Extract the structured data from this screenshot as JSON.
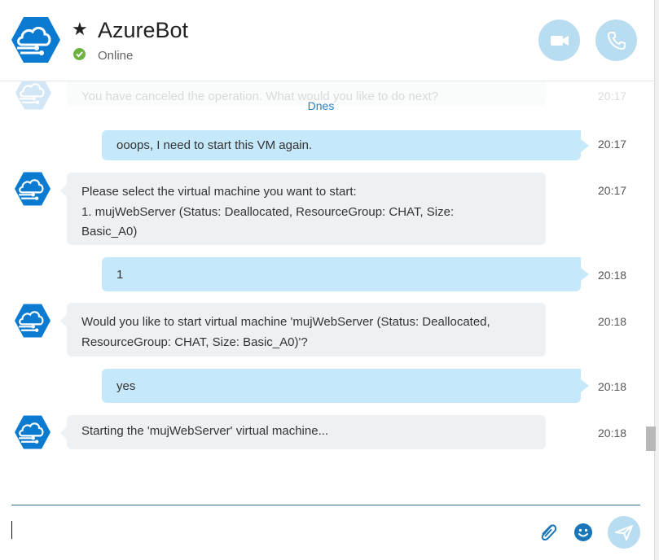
{
  "header": {
    "title": "AzureBot",
    "status": "Online",
    "favorite_icon": "star-icon",
    "video_icon": "video-camera-icon",
    "call_icon": "phone-icon"
  },
  "date_separator": "Dnes",
  "ghost_message": {
    "text": "You have canceled the operation. What would you like to do next?",
    "time": "20:17"
  },
  "messages": [
    {
      "from": "me",
      "lines": [
        "ooops, I need to start this VM again."
      ],
      "time": "20:17"
    },
    {
      "from": "bot",
      "lines": [
        "Please select the virtual machine you want to start:",
        "1. mujWebServer (Status: Deallocated, ResourceGroup: CHAT, Size:",
        "Basic_A0)"
      ],
      "time": "20:17"
    },
    {
      "from": "me",
      "lines": [
        "1"
      ],
      "time": "20:18"
    },
    {
      "from": "bot",
      "lines": [
        "Would you like to start virtual machine 'mujWebServer (Status: Deallocated,",
        "ResourceGroup: CHAT, Size: Basic_A0)'?"
      ],
      "time": "20:18"
    },
    {
      "from": "me",
      "lines": [
        "yes"
      ],
      "time": "20:18"
    },
    {
      "from": "bot",
      "lines": [
        "Starting the 'mujWebServer' virtual machine..."
      ],
      "time": "20:18"
    }
  ],
  "compose": {
    "placeholder": "",
    "attach_icon": "paperclip-icon",
    "emoji_icon": "emoji-icon",
    "send_icon": "send-icon"
  },
  "colors": {
    "accent": "#b8dcf0",
    "incoming_bubble": "#eef1f4",
    "outgoing_bubble": "#c5e8fa",
    "online": "#6cb33f",
    "azure_blue": "#0a7bd1"
  }
}
